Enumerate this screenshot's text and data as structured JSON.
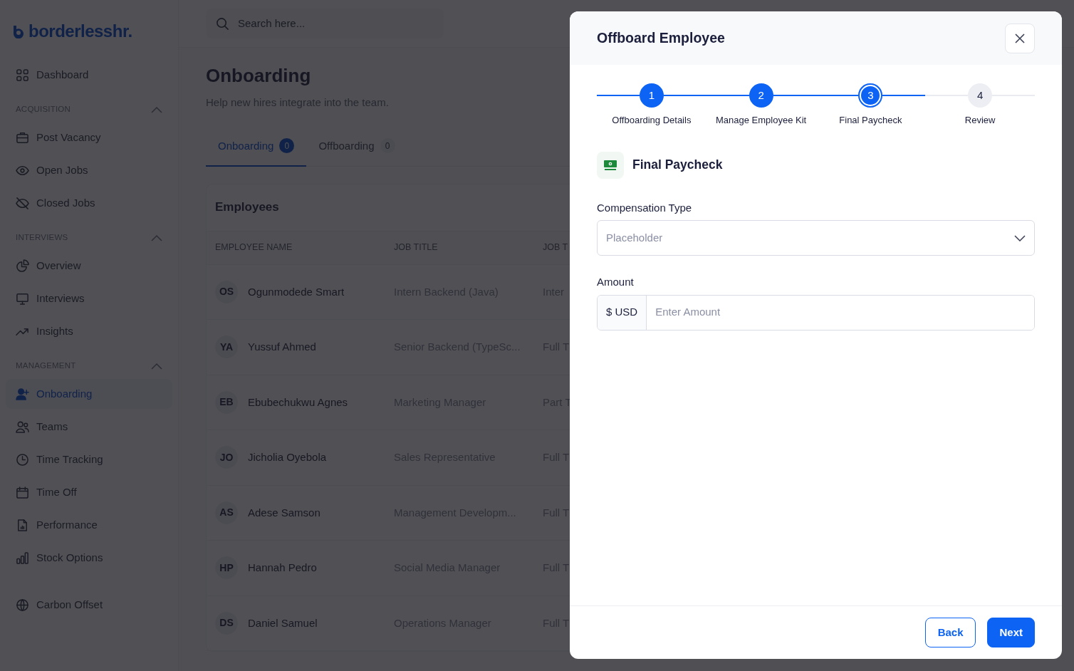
{
  "logo": "borderlesshr.",
  "sidebar": {
    "items": [
      {
        "label": "Dashboard",
        "selected": false
      }
    ],
    "sections": [
      {
        "title": "ACQUISITION",
        "expanded": true,
        "items": [
          {
            "label": "Post Vacancy",
            "selected": false
          },
          {
            "label": "Open Jobs",
            "selected": false
          },
          {
            "label": "Closed Jobs",
            "selected": false
          }
        ]
      },
      {
        "title": "INTERVIEWS",
        "expanded": true,
        "items": [
          {
            "label": "Overview",
            "selected": false
          },
          {
            "label": "Interviews",
            "selected": false
          },
          {
            "label": "Insights",
            "selected": false
          }
        ]
      },
      {
        "title": "MANAGEMENT",
        "expanded": true,
        "items": [
          {
            "label": "Onboarding",
            "selected": true
          },
          {
            "label": "Teams",
            "selected": false
          },
          {
            "label": "Time Tracking",
            "selected": false
          },
          {
            "label": "Time Off",
            "selected": false
          },
          {
            "label": "Performance",
            "selected": false
          },
          {
            "label": "Stock Options",
            "selected": false
          }
        ]
      }
    ],
    "footer_items": [
      {
        "label": "Carbon Offset",
        "selected": false
      }
    ]
  },
  "search": {
    "placeholder": "Search here..."
  },
  "page": {
    "title": "Onboarding",
    "subtitle": "Help new hires integrate into the team."
  },
  "tabs": [
    {
      "label": "Onboarding",
      "count": "0",
      "selected": true
    },
    {
      "label": "Offboarding",
      "count": "0",
      "selected": false
    }
  ],
  "table": {
    "title": "Employees",
    "columns": [
      "EMPLOYEE NAME",
      "JOB TITLE",
      "JOB T"
    ],
    "rows": [
      {
        "initials": "OS",
        "name": "Ogunmodede Smart",
        "job_title": "Intern Backend (Java)",
        "column_3": "Inter"
      },
      {
        "initials": "YA",
        "name": "Yussuf Ahmed",
        "job_title": "Senior Backend (TypeSc...",
        "column_3": "Full T"
      },
      {
        "initials": "EB",
        "name": "Ebubechukwu Agnes",
        "job_title": "Marketing Manager",
        "column_3": "Part T"
      },
      {
        "initials": "JO",
        "name": "Jicholia Oyebola",
        "job_title": "Sales Representative",
        "column_3": "Full T"
      },
      {
        "initials": "AS",
        "name": "Adese Samson",
        "job_title": "Management Developm...",
        "column_3": "Full T"
      },
      {
        "initials": "HP",
        "name": "Hannah Pedro",
        "job_title": "Social Media Manager",
        "column_3": "Full T"
      },
      {
        "initials": "DS",
        "name": "Daniel Samuel",
        "job_title": "Operations Manager",
        "column_3": "Full T"
      }
    ]
  },
  "modal": {
    "title": "Offboard Employee",
    "steps": [
      {
        "number": "1",
        "label": "Offboarding Details",
        "completed": true,
        "selected": false
      },
      {
        "number": "2",
        "label": "Manage Employee Kit",
        "completed": true,
        "selected": false
      },
      {
        "number": "3",
        "label": "Final Paycheck",
        "completed": false,
        "selected": true
      },
      {
        "number": "4",
        "label": "Review",
        "completed": false,
        "selected": false
      }
    ],
    "section_title": "Final Paycheck",
    "fields": [
      {
        "kind": "select",
        "label": "Compensation Type",
        "placeholder": "Placeholder"
      },
      {
        "kind": "amount",
        "label": "Amount",
        "prefix": "$ USD",
        "placeholder": "Enter Amount"
      }
    ],
    "buttons": [
      {
        "kind": "secondary",
        "label": "Back"
      },
      {
        "kind": "primary",
        "label": "Next"
      }
    ]
  }
}
